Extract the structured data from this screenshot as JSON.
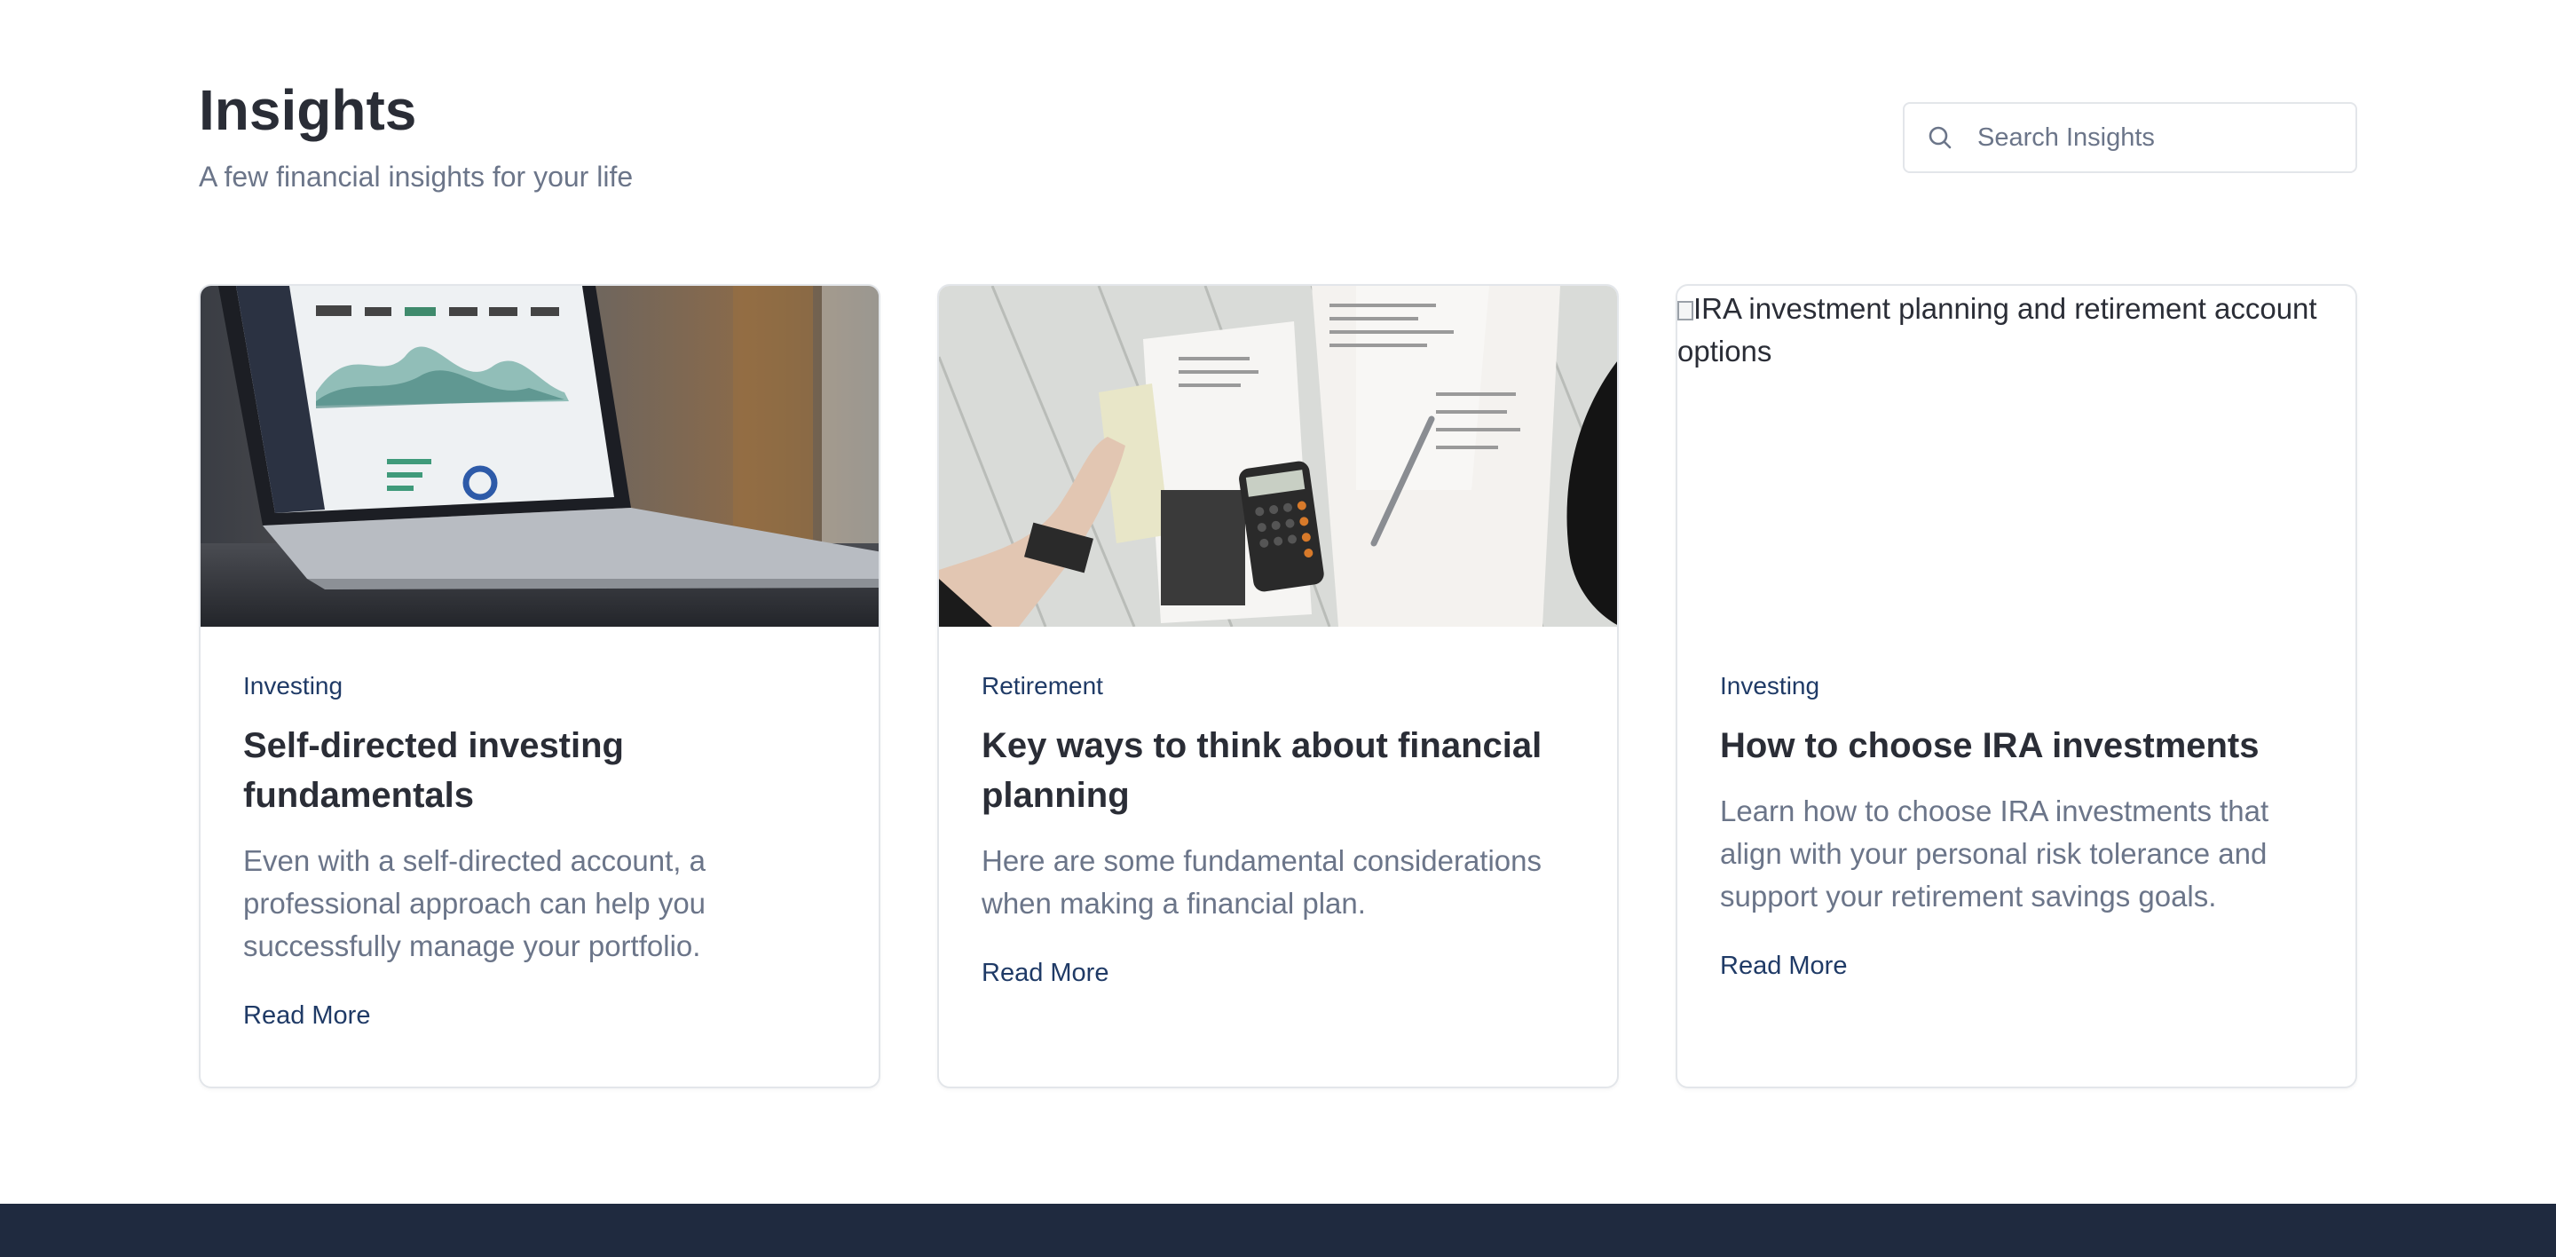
{
  "header": {
    "title": "Insights",
    "subtitle": "A few financial insights for your life"
  },
  "search": {
    "placeholder": "Search Insights",
    "value": ""
  },
  "cards": [
    {
      "category": "Investing",
      "title": "Self-directed investing fundamentals",
      "description": "Even with a self-directed account, a professional approach can help you successfully manage your portfolio.",
      "link_label": "Read More",
      "image_icon": "laptop-dashboard-photo"
    },
    {
      "category": "Retirement",
      "title": "Key ways to think about financial planning",
      "description": "Here are some fundamental considerations when making a financial plan.",
      "link_label": "Read More",
      "image_icon": "tax-documents-calculator-photo"
    },
    {
      "category": "Investing",
      "title": "How to choose IRA investments",
      "description": "Learn how to choose IRA investments that align with your personal risk tolerance and support your retirement savings goals.",
      "link_label": "Read More",
      "image_alt": "IRA investment planning and retirement account options"
    }
  ],
  "colors": {
    "accent": "#1f3a66",
    "muted_text": "#6b7589",
    "footer": "#1f2a3f"
  }
}
